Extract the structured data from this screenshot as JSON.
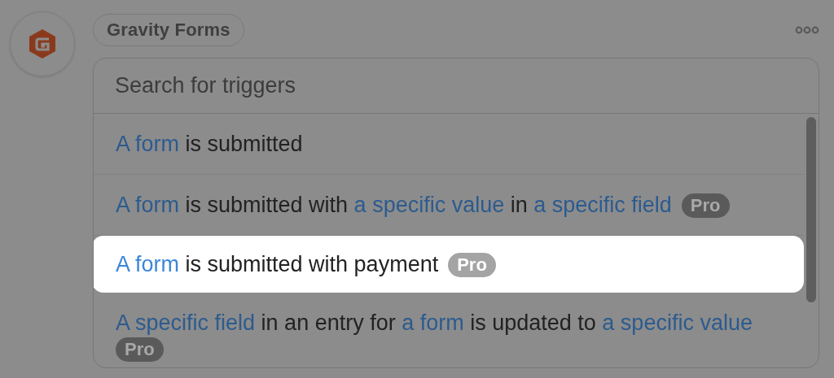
{
  "app": {
    "name": "Gravity Forms"
  },
  "search": {
    "placeholder": "Search for triggers"
  },
  "triggers": [
    {
      "parts": [
        {
          "text": "A form",
          "kind": "link"
        },
        {
          "text": " is submitted",
          "kind": "plain"
        }
      ],
      "highlighted": false
    },
    {
      "parts": [
        {
          "text": "A form",
          "kind": "link"
        },
        {
          "text": " is submitted with ",
          "kind": "plain"
        },
        {
          "text": "a specific value",
          "kind": "link"
        },
        {
          "text": " in ",
          "kind": "plain"
        },
        {
          "text": "a specific field",
          "kind": "link"
        }
      ],
      "badge": "Pro",
      "highlighted": false
    },
    {
      "parts": [
        {
          "text": "A form",
          "kind": "link"
        },
        {
          "text": " is submitted with payment",
          "kind": "plain"
        }
      ],
      "badge": "Pro",
      "highlighted": true
    },
    {
      "parts": [
        {
          "text": "A specific field",
          "kind": "link"
        },
        {
          "text": " in an entry for ",
          "kind": "plain"
        },
        {
          "text": "a form",
          "kind": "link"
        },
        {
          "text": " is updated to ",
          "kind": "plain"
        },
        {
          "text": "a specific value",
          "kind": "link"
        }
      ],
      "badge": "Pro",
      "highlighted": false
    }
  ]
}
